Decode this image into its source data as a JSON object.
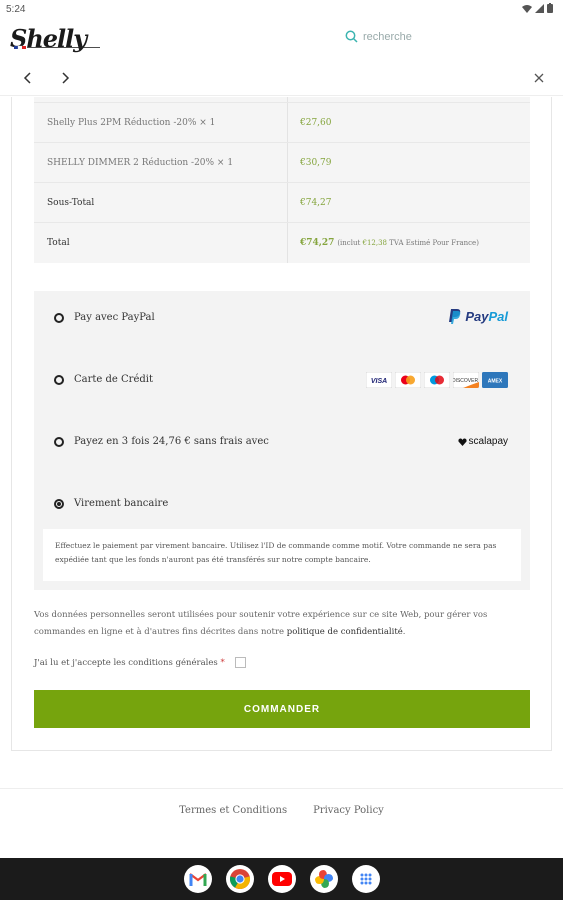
{
  "status": {
    "time": "5:24"
  },
  "header": {
    "logo": "Shelly",
    "logo_sub": "FRANCE",
    "search_placeholder": "recherche"
  },
  "order_table": {
    "rows": [
      {
        "label": "Shelly Plus 2PM Réduction -20%  × 1",
        "value": "€27,60"
      },
      {
        "label": "SHELLY DIMMER 2 Réduction -20%  × 1",
        "value": "€30,79"
      },
      {
        "label": "Sous-Total",
        "value": "€74,27"
      },
      {
        "label": "Total",
        "value": "€74,27",
        "note_prefix": "(inclut ",
        "note_amount": "€12,38",
        "note_suffix": " TVA Estimé Pour France)"
      }
    ]
  },
  "payment": {
    "options": [
      {
        "label": "Pay avec PayPal",
        "logo": "PayPal"
      },
      {
        "label": "Carte de Crédit"
      },
      {
        "label": "Payez en 3 fois 24,76 € sans frais avec",
        "logo": "scalapay"
      },
      {
        "label": "Virement bancaire"
      }
    ],
    "card_brands": [
      "VISA",
      "MC",
      "MAESTRO",
      "DISCOVER",
      "AMEX"
    ],
    "description": "Effectuez le paiement par virement bancaire. Utilisez l'ID de commande comme motif. Votre commande ne sera pas expédiée tant que les fonds n'auront pas été transférés sur notre compte bancaire."
  },
  "privacy": {
    "text": "Vos données personnelles seront utilisées pour soutenir votre expérience sur ce site Web, pour gérer vos commandes en ligne et à d'autres fins décrites dans notre ",
    "link": "politique de confidentialité",
    "end": "."
  },
  "terms": {
    "label": "J'ai lu et j'accepte les conditions générales",
    "required": "*"
  },
  "order_button": {
    "label": "COMMANDER"
  },
  "footer": {
    "links": [
      "Termes et Conditions",
      "Privacy Policy"
    ]
  },
  "colors": {
    "accent": "#76a40d",
    "price": "#85a53e",
    "paypal_dark": "#253b80",
    "paypal_light": "#179bd7"
  }
}
